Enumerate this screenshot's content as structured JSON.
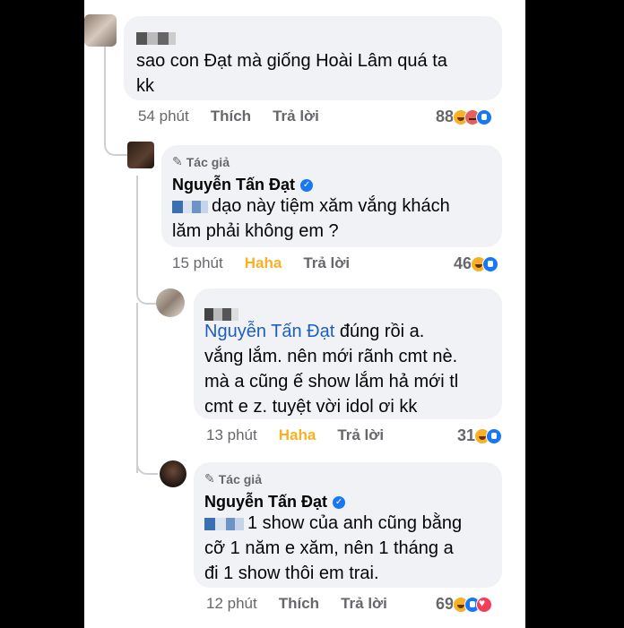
{
  "comments": [
    {
      "text_lines": [
        "sao con Đạt mà giống Hoài Lâm quá ta",
        "kk"
      ],
      "time": "54 phút",
      "action": "Thích",
      "reply": "Trả lời",
      "reaction_count": "88",
      "reactions": [
        "haha",
        "angry",
        "like"
      ]
    },
    {
      "author_tag": "Tác giả",
      "author": "Nguyễn Tấn Đạt",
      "text_lines": [
        "dạo này tiệm xăm vắng khách",
        "lăm phải không em ?"
      ],
      "time": "15 phút",
      "action": "Haha",
      "reply": "Trả lời",
      "reaction_count": "46",
      "reactions": [
        "haha",
        "like"
      ]
    },
    {
      "mention": "Nguyễn Tấn Đạt",
      "text_lines": [
        "đúng rồi a.",
        "vắng lắm. nên mới rãnh cmt nè.",
        "mà a cũng ế show lắm hả mới tl",
        "cmt e z. tuyệt vời idol ơi kk"
      ],
      "time": "13 phút",
      "action": "Haha",
      "reply": "Trả lời",
      "reaction_count": "31",
      "reactions": [
        "haha",
        "like"
      ]
    },
    {
      "author_tag": "Tác giả",
      "author": "Nguyễn Tấn Đạt",
      "text_lines": [
        "1 show của anh cũng bằng",
        "cỡ 1 năm e xăm, nên 1 tháng a",
        "đi 1 show thôi em trai."
      ],
      "time": "12 phút",
      "action": "Thích",
      "reply": "Trả lời",
      "reaction_count": "69",
      "reactions": [
        "haha",
        "like",
        "love"
      ]
    }
  ],
  "colors": {
    "mention": "#1d5fbf",
    "haha_action": "#f7b125",
    "bubble": "#f0f2f5",
    "verified": "#1877f2"
  },
  "icons": {
    "author_tag": "pencil-icon",
    "verified": "verified-badge-icon"
  }
}
